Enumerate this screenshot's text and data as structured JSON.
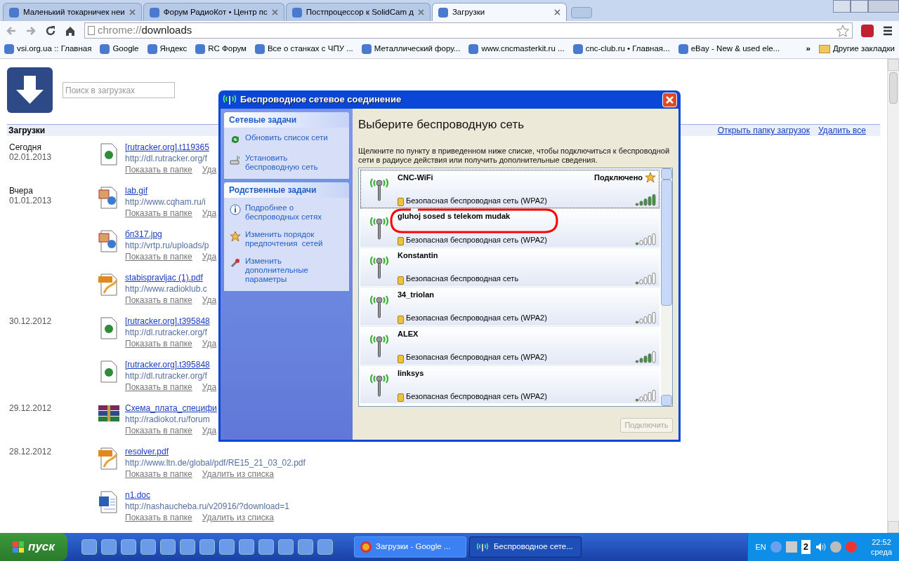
{
  "browser": {
    "tabs": [
      {
        "title": "Маленький токарничек неи",
        "selected": false
      },
      {
        "title": "Форум РадиоКот • Центр пс",
        "selected": false
      },
      {
        "title": "Постпроцессор к SolidCam д",
        "selected": false
      },
      {
        "title": "Загрузки",
        "selected": true
      }
    ],
    "address_scheme": "chrome://",
    "address_path": "downloads",
    "bookmarks": [
      "vsi.org.ua :: Главная",
      "Google",
      "Яндекс",
      "RC Форум",
      "Все о станках с ЧПУ ...",
      "Металлический фору...",
      "www.cncmasterkit.ru ...",
      "cnc-club.ru • Главная...",
      "eBay - New & used ele..."
    ],
    "more": "»",
    "other_bookmarks": "Другие закладки"
  },
  "downloads": {
    "search_placeholder": "Поиск в загрузках",
    "heading": "Загрузки",
    "open_folder": "Открыть папку загрузок",
    "clear_all": "Удалить все",
    "groups": [
      {
        "day": "Сегодня",
        "date": "02.01.2013",
        "items": [
          {
            "kind": "torrent",
            "name": "[rutracker.org].t119365",
            "url": "http://dl.rutracker.org/f",
            "show": "Показать в папке",
            "remove": "Уда"
          }
        ]
      },
      {
        "day": "Вчера",
        "date": "01.01.2013",
        "items": [
          {
            "kind": "image",
            "name": "lab.gif",
            "url": "http://www.cqham.ru/i",
            "show": "Показать в папке",
            "remove": "Уда"
          },
          {
            "kind": "image",
            "name": "бп317.jpg",
            "url": "http://vrtp.ru/uploads/p",
            "show": "Показать в папке",
            "remove": "Уда"
          },
          {
            "kind": "pdf",
            "name": "stabispravljac (1).pdf",
            "url": "http://www.radioklub.c",
            "show": "Показать в папке",
            "remove": "Уда"
          }
        ]
      },
      {
        "date": "30.12.2012",
        "items": [
          {
            "kind": "torrent",
            "name": "[rutracker.org].t395848",
            "url": "http://dl.rutracker.org/f",
            "show": "Показать в папке",
            "remove": "Уда"
          },
          {
            "kind": "torrent",
            "name": "[rutracker.org].t395848",
            "url": "http://dl.rutracker.org/f",
            "show": "Показать в папке",
            "remove": "Уда"
          }
        ]
      },
      {
        "date": "29.12.2012",
        "items": [
          {
            "kind": "archive",
            "name": "Схема_плата_специфи",
            "url": "http://radiokot.ru/forum",
            "show": "Показать в папке",
            "remove": "Уда"
          }
        ]
      },
      {
        "date": "28.12.2012",
        "items": [
          {
            "kind": "pdf",
            "name": "resolver.pdf",
            "url": "http://www.ltn.de/global/pdf/RE15_21_03_02.pdf",
            "show": "Показать в папке",
            "remove": "Удалить из списка"
          },
          {
            "kind": "doc",
            "name": "n1.doc",
            "url": "http://nashaucheba.ru/v20916/?download=1",
            "show": "Показать в папке",
            "remove": "Удалить из списка"
          }
        ]
      }
    ]
  },
  "dialog": {
    "title": "Беспроводное сетевое соединение",
    "task_groups": [
      {
        "title": "Сетевые задачи",
        "items": [
          {
            "kind": "refresh",
            "label": "Обновить список сети"
          },
          {
            "kind": "setup",
            "label": "Установить беспроводную сеть"
          }
        ]
      },
      {
        "title": "Родственные задачи",
        "items": [
          {
            "kind": "info",
            "label": "Подробнее о беспроводных сетях"
          },
          {
            "kind": "star",
            "label": "Изменить порядок предпочтения  сетей"
          },
          {
            "kind": "tools",
            "label": "Изменить дополнительные параметры"
          }
        ]
      }
    ],
    "heading": "Выберите беспроводную сеть",
    "instructions": "Щелкните по пункту в приведенном ниже списке, чтобы подключиться к беспроводной сети в радиусе действия или получить дополнительные сведения.",
    "networks": [
      {
        "name": "CNC-WiFi",
        "status": "Подключено",
        "security": "Безопасная беспроводная сеть (WPA2)",
        "level": 1,
        "selected": true
      },
      {
        "name": "gluhoj sosed s telekom mudak",
        "security": "Безопасная беспроводная сеть (WPA2)",
        "level": 0.2,
        "selected": false
      },
      {
        "name": "Konstantin",
        "security": "Безопасная беспроводная сеть",
        "level": 0.2,
        "selected": false
      },
      {
        "name": "34_triolan",
        "security": "Безопасная беспроводная сеть (WPA2)",
        "level": 0.2,
        "selected": false
      },
      {
        "name": "ALEX",
        "security": "Безопасная беспроводная сеть (WPA2)",
        "level": 0.8,
        "selected": false
      },
      {
        "name": "linksys",
        "security": "Безопасная беспроводная сеть (WPA2)",
        "level": 0.2,
        "selected": false
      }
    ],
    "connect_button": "Подключить",
    "connect_disabled": true
  },
  "taskbar": {
    "start": "пуск",
    "tasks": [
      {
        "kind": "browser",
        "label": "Загрузки - Google ...",
        "selected": false
      },
      {
        "kind": "wireless",
        "label": "Беспроводное сете...",
        "selected": true
      }
    ],
    "language": "EN",
    "tray_badge": "2",
    "time": "22:52",
    "day": "среда"
  }
}
